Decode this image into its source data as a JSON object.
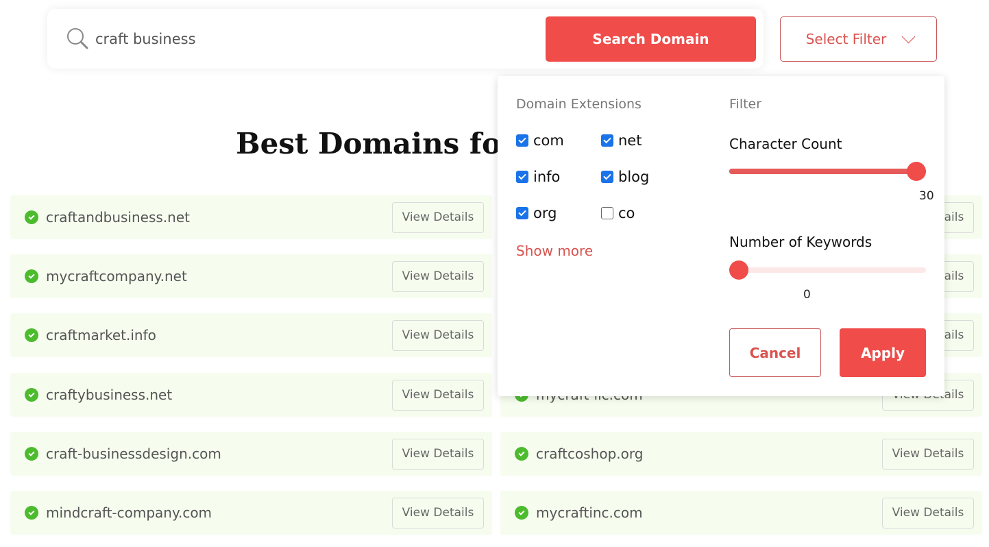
{
  "search": {
    "value": "craft business",
    "icon": "search-icon",
    "button_label": "Search Domain"
  },
  "filter_button": {
    "label": "Select Filter",
    "icon": "chevron-down-icon"
  },
  "heading": "Best Domains for craft business",
  "results": {
    "left": [
      {
        "domain": "craftandbusiness.net",
        "button": "View Details"
      },
      {
        "domain": "mycraftcompany.net",
        "button": "View Details"
      },
      {
        "domain": "craftmarket.info",
        "button": "View Details"
      },
      {
        "domain": "craftybusiness.net",
        "button": "View Details"
      },
      {
        "domain": "craft-businessdesign.com",
        "button": "View Details"
      },
      {
        "domain": "mindcraft-company.com",
        "button": "View Details"
      }
    ],
    "right": [
      {
        "domain": "",
        "button": "View Details"
      },
      {
        "domain": "",
        "button": "View Details"
      },
      {
        "domain": "",
        "button": "View Details"
      },
      {
        "domain": "mycraft-llc.com",
        "button": "View Details"
      },
      {
        "domain": "craftcoshop.org",
        "button": "View Details"
      },
      {
        "domain": "mycraftinc.com",
        "button": "View Details"
      }
    ]
  },
  "popup": {
    "extensions_label": "Domain Extensions",
    "extensions": [
      {
        "label": "com",
        "checked": true
      },
      {
        "label": "net",
        "checked": true
      },
      {
        "label": "info",
        "checked": true
      },
      {
        "label": "blog",
        "checked": true
      },
      {
        "label": "org",
        "checked": true
      },
      {
        "label": "co",
        "checked": false
      }
    ],
    "show_more": "Show more",
    "filter_label": "Filter",
    "character_count": {
      "label": "Character Count",
      "value": "30",
      "fraction": 1.0
    },
    "keywords": {
      "label": "Number of Keywords",
      "value": "0",
      "fraction": 0.0
    },
    "cancel_label": "Cancel",
    "apply_label": "Apply"
  },
  "colors": {
    "accent": "#ef4c4a",
    "row_bg": "#f6fdef",
    "check_green": "#4cbb2e",
    "checkbox_blue": "#1a73e8"
  }
}
